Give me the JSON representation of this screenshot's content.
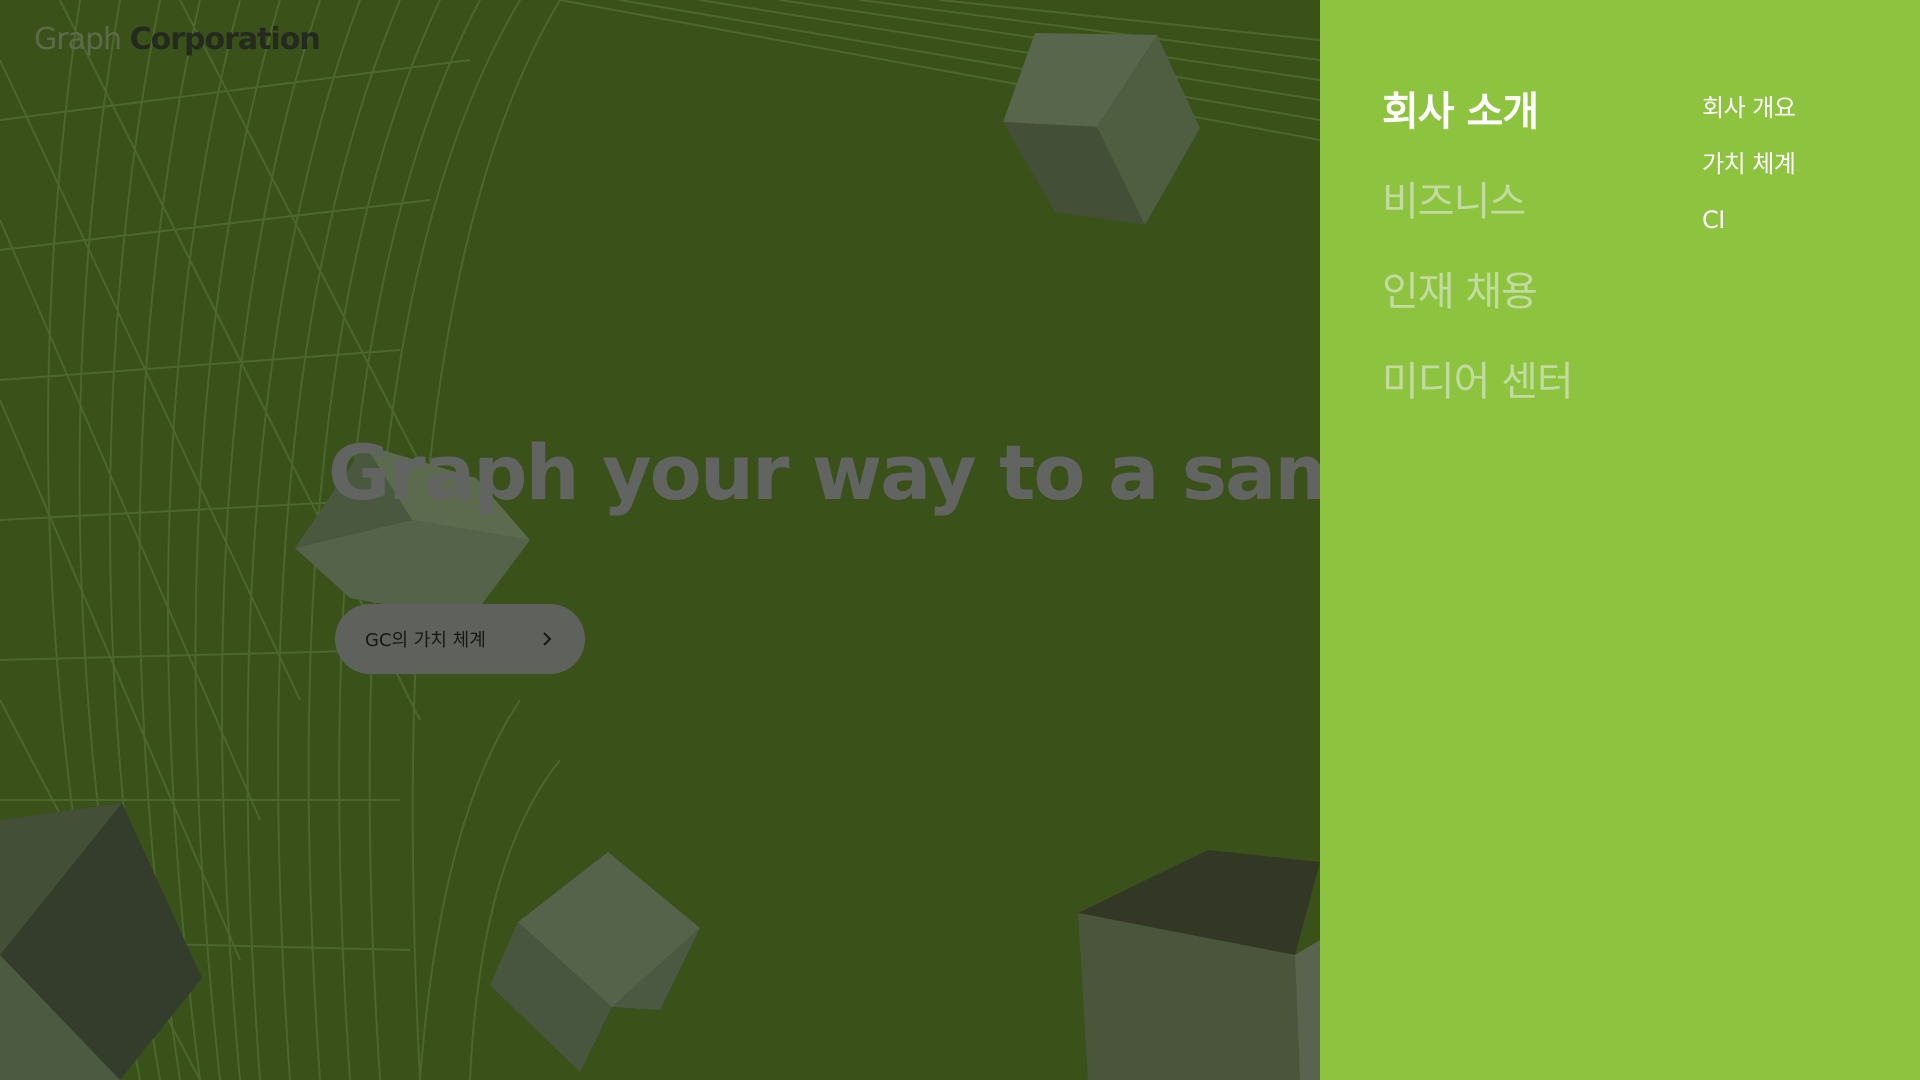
{
  "header": {
    "logo": {
      "light": "Graph",
      "dark": "Corporation"
    }
  },
  "hero": {
    "headline": "Graph your way to a samate",
    "cta": {
      "label": "GC의 가치 체계",
      "icon": "chevron-right-icon"
    }
  },
  "nav": {
    "main_items": [
      {
        "label": "회사 소개",
        "active": true
      },
      {
        "label": "비즈니스",
        "active": false
      },
      {
        "label": "인재 채용",
        "active": false
      },
      {
        "label": "미디어 센터",
        "active": false
      }
    ],
    "sub_items": [
      {
        "label": "회사 개요"
      },
      {
        "label": "가치 체계"
      },
      {
        "label": "CI"
      }
    ]
  },
  "colors": {
    "hero_bg": "#3a5119",
    "menu_bg": "#8dc33e",
    "menu_active": "#ffffff",
    "menu_inactive": "#c2dba0",
    "cta_bg": "#5f625c",
    "headline": "#626462"
  }
}
